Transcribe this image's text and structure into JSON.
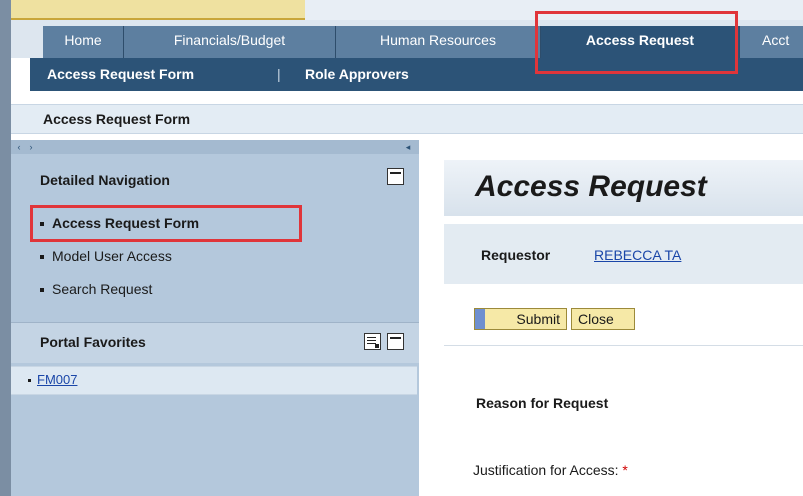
{
  "tabs": [
    {
      "label": "Home"
    },
    {
      "label": "Financials/Budget"
    },
    {
      "label": "Human Resources"
    },
    {
      "label": "Access Request",
      "active": true
    },
    {
      "label": "Acct"
    }
  ],
  "subnav": {
    "items": [
      "Access Request Form",
      "Role Approvers"
    ],
    "separator": "|"
  },
  "page_title": "Access Request Form",
  "nav_toggle": {
    "left": "‹",
    "right": "›",
    "collapse": "◂"
  },
  "detailed_navigation": {
    "heading": "Detailed Navigation",
    "items": [
      {
        "label": "Access Request Form",
        "selected": true
      },
      {
        "label": "Model User Access"
      },
      {
        "label": "Search Request"
      }
    ]
  },
  "portal_favorites": {
    "heading": "Portal Favorites",
    "items": [
      {
        "label": "FM007"
      }
    ]
  },
  "content": {
    "title": "Access Request",
    "requestor_label": "Requestor",
    "requestor_value": "REBECCA TA",
    "submit_label": "Submit",
    "close_label": "Close",
    "reason_label": "Reason for Request",
    "justification_label": "Justification for Access:",
    "required_marker": "*"
  },
  "colors": {
    "tab": "#5d7fa0",
    "tab_active": "#2c5377",
    "nav_panel": "#b4c8dc",
    "button": "#f6e9a7",
    "highlight": "#e0353a",
    "link": "#1a46a8"
  }
}
